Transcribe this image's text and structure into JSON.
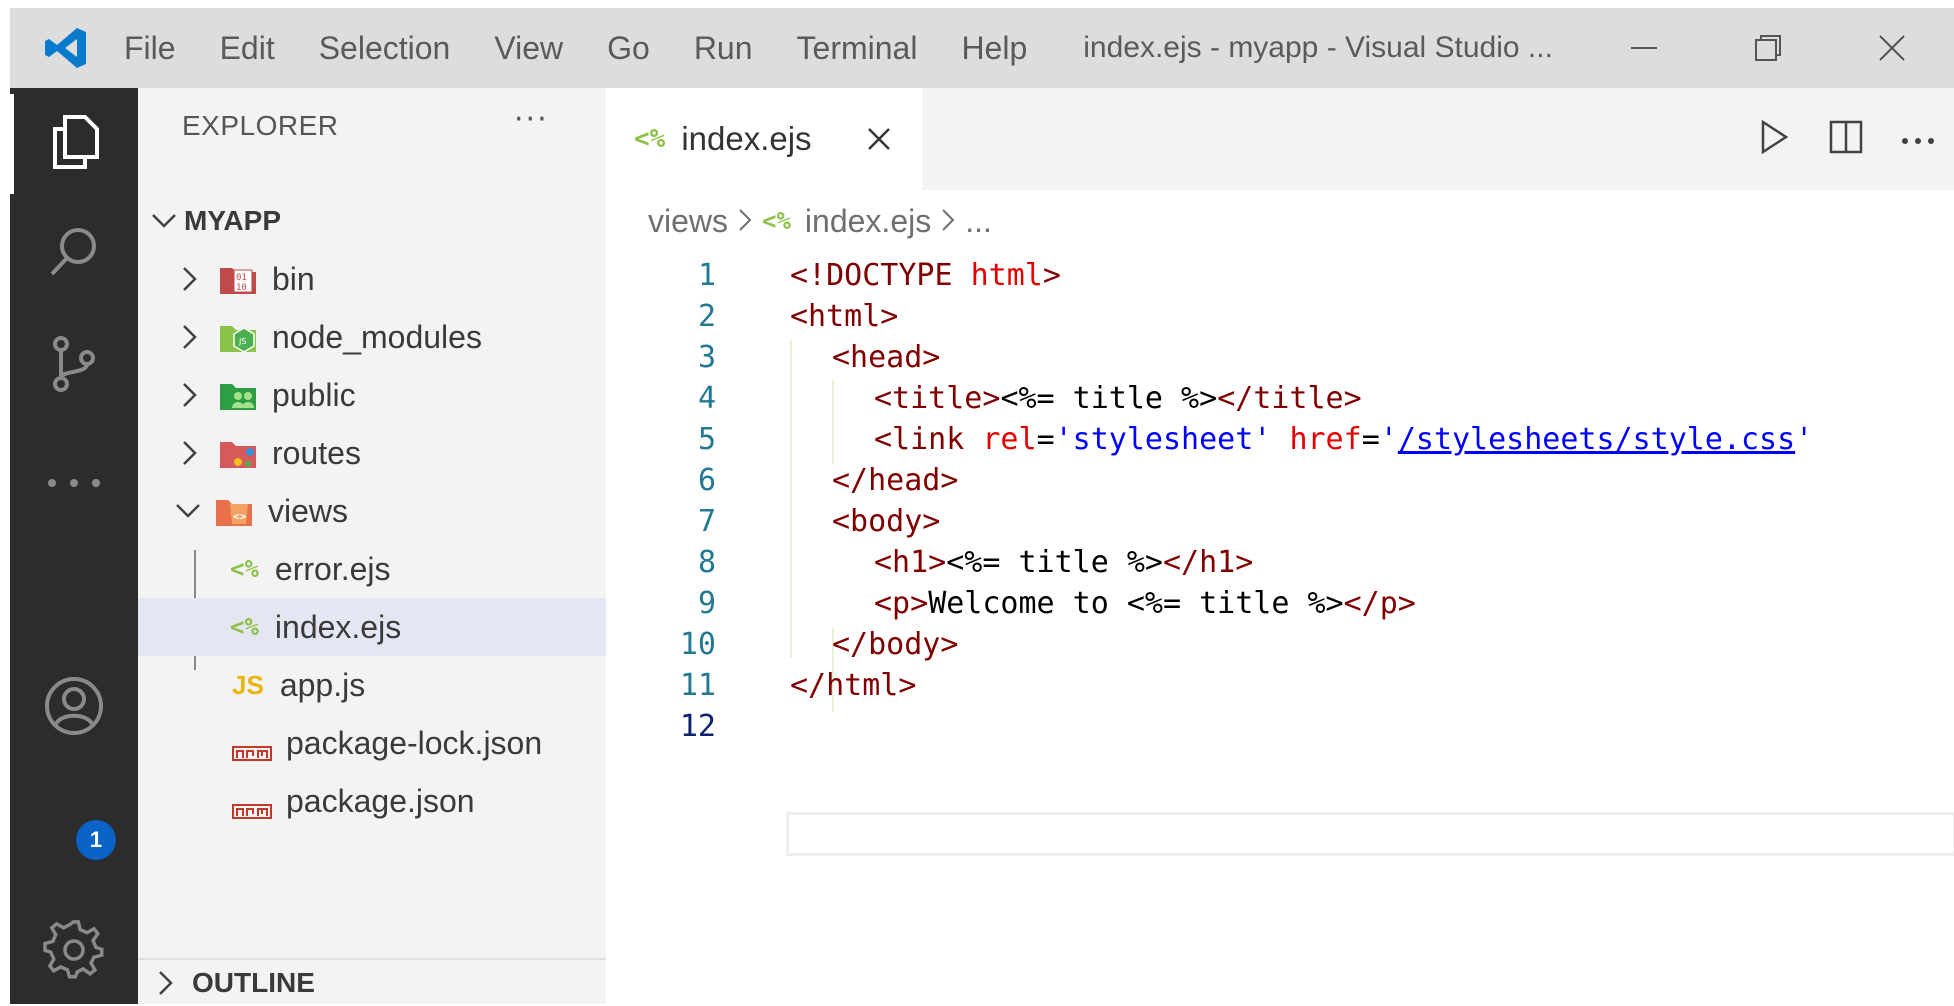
{
  "menu": [
    "File",
    "Edit",
    "Selection",
    "View",
    "Go",
    "Run",
    "Terminal",
    "Help"
  ],
  "window_title": "index.ejs - myapp - Visual Studio ...",
  "accounts_badge": "1",
  "explorer": {
    "title": "EXPLORER",
    "more": "···",
    "root": "MYAPP",
    "items": [
      {
        "label": "bin",
        "kind": "folder",
        "icon": "folder-bin-icon"
      },
      {
        "label": "node_modules",
        "kind": "folder",
        "icon": "folder-node-icon"
      },
      {
        "label": "public",
        "kind": "folder",
        "icon": "folder-public-icon"
      },
      {
        "label": "routes",
        "kind": "folder",
        "icon": "folder-routes-icon"
      },
      {
        "label": "views",
        "kind": "folder-open",
        "icon": "folder-views-icon"
      },
      {
        "label": "error.ejs",
        "kind": "ejs"
      },
      {
        "label": "index.ejs",
        "kind": "ejs",
        "selected": true
      },
      {
        "label": "app.js",
        "kind": "js"
      },
      {
        "label": "package-lock.json",
        "kind": "npm"
      },
      {
        "label": "package.json",
        "kind": "npm"
      }
    ],
    "outline": "OUTLINE"
  },
  "tab": {
    "label": "index.ejs",
    "icon_text": "<%"
  },
  "breadcrumbs": {
    "folder": "views",
    "file": "index.ejs",
    "icon_text": "<%",
    "tail": "..."
  },
  "code_lines": [
    "1",
    "2",
    "3",
    "4",
    "5",
    "6",
    "7",
    "8",
    "9",
    "10",
    "11",
    "12"
  ],
  "code": {
    "l1a": "<!DOCTYPE ",
    "l1b": "html",
    "l1c": ">",
    "l2": "<html>",
    "l3": "<head>",
    "l4a": "<title>",
    "l4b": "<%= title %>",
    "l4c": "</title>",
    "l5a": "<link ",
    "l5b": "rel",
    "l5c": "=",
    "l5d": "'stylesheet'",
    "l5e": " ",
    "l5f": "href",
    "l5g": "=",
    "l5h": "'",
    "l5i": "/stylesheets/style.css",
    "l5j": "'",
    "l6": "</head>",
    "l7": "<body>",
    "l8a": "<h1>",
    "l8b": "<%= title %>",
    "l8c": "</h1>",
    "l9a": "<p>",
    "l9b": "Welcome to <%= title %>",
    "l9c": "</p>",
    "l10": "</body>",
    "l11": "</html>"
  }
}
